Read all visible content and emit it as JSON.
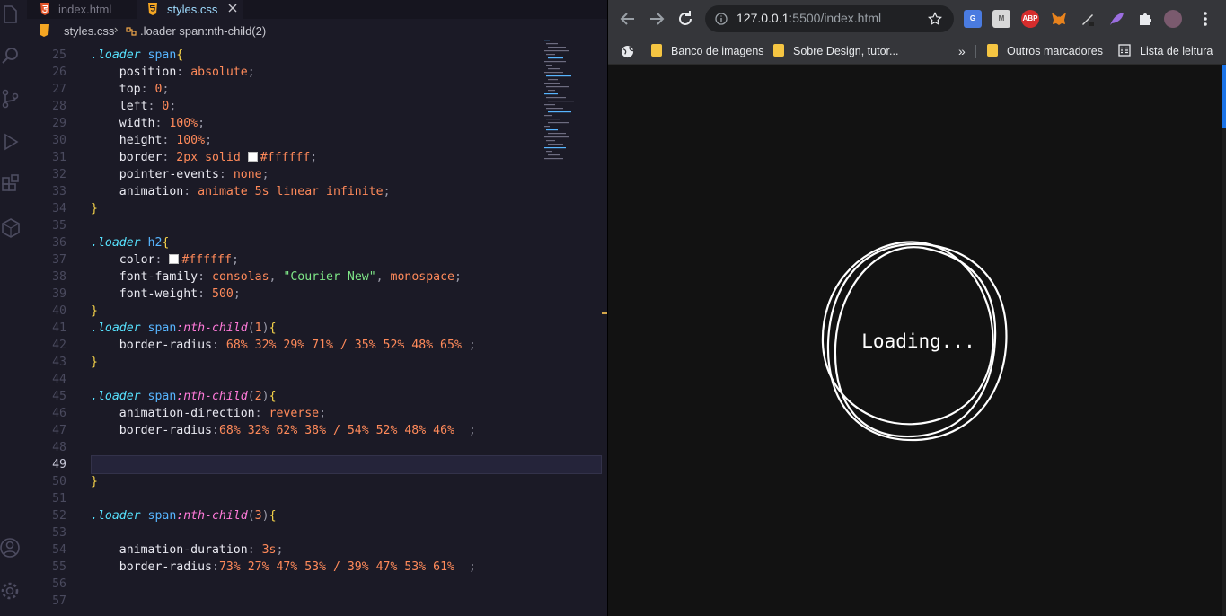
{
  "editor": {
    "tabs": [
      {
        "label": "index.html",
        "type": "html"
      },
      {
        "label": "styles.css",
        "type": "css",
        "active": true
      }
    ],
    "breadcrumb": {
      "file": "styles.css",
      "selector": ".loader span:nth-child(2)"
    },
    "active_line": "49"
  },
  "browser": {
    "url_host": "127.0.0.1",
    "url_rest": ":5500/index.html",
    "bookmarks": [
      "Banco de imagens",
      "Sobre Design, tutor...",
      "Outros marcadores",
      "Lista de leitura"
    ],
    "overflow": "»",
    "extensions": [
      "G",
      "M",
      "ABP",
      "fox",
      "pen",
      "feather",
      "puzzle",
      "avatar"
    ],
    "page_text": "Loading..."
  },
  "code": [
    {
      "n": "25",
      "t": [
        [
          "sel",
          ".loader"
        ],
        [
          "txt",
          " "
        ],
        [
          "tag",
          "span"
        ],
        [
          "br",
          "{"
        ]
      ]
    },
    {
      "n": "26",
      "t": [
        [
          "txt",
          "    "
        ],
        [
          "prop",
          "position"
        ],
        [
          "p",
          ": "
        ],
        [
          "val",
          "absolute"
        ],
        [
          "p",
          ";"
        ]
      ]
    },
    {
      "n": "27",
      "t": [
        [
          "txt",
          "    "
        ],
        [
          "prop",
          "top"
        ],
        [
          "p",
          ": "
        ],
        [
          "num",
          "0"
        ],
        [
          "p",
          ";"
        ]
      ]
    },
    {
      "n": "28",
      "t": [
        [
          "txt",
          "    "
        ],
        [
          "prop",
          "left"
        ],
        [
          "p",
          ": "
        ],
        [
          "num",
          "0"
        ],
        [
          "p",
          ";"
        ]
      ]
    },
    {
      "n": "29",
      "t": [
        [
          "txt",
          "    "
        ],
        [
          "prop",
          "width"
        ],
        [
          "p",
          ": "
        ],
        [
          "num",
          "100%"
        ],
        [
          "p",
          ";"
        ]
      ]
    },
    {
      "n": "30",
      "t": [
        [
          "txt",
          "    "
        ],
        [
          "prop",
          "height"
        ],
        [
          "p",
          ": "
        ],
        [
          "num",
          "100%"
        ],
        [
          "p",
          ";"
        ]
      ]
    },
    {
      "n": "31",
      "t": [
        [
          "txt",
          "    "
        ],
        [
          "prop",
          "border"
        ],
        [
          "p",
          ": "
        ],
        [
          "num",
          "2px"
        ],
        [
          "val",
          " solid "
        ],
        [
          "sw",
          ""
        ],
        [
          "val",
          "#ffffff"
        ],
        [
          "p",
          ";"
        ]
      ]
    },
    {
      "n": "32",
      "t": [
        [
          "txt",
          "    "
        ],
        [
          "prop",
          "pointer-events"
        ],
        [
          "p",
          ": "
        ],
        [
          "val",
          "none"
        ],
        [
          "p",
          ";"
        ]
      ]
    },
    {
      "n": "33",
      "t": [
        [
          "txt",
          "    "
        ],
        [
          "prop",
          "animation"
        ],
        [
          "p",
          ": "
        ],
        [
          "val",
          "animate 5s linear infinite"
        ],
        [
          "p",
          ";"
        ]
      ]
    },
    {
      "n": "34",
      "t": [
        [
          "br",
          "}"
        ]
      ]
    },
    {
      "n": "35",
      "t": []
    },
    {
      "n": "36",
      "t": [
        [
          "sel",
          ".loader"
        ],
        [
          "txt",
          " "
        ],
        [
          "tag",
          "h2"
        ],
        [
          "br",
          "{"
        ]
      ]
    },
    {
      "n": "37",
      "t": [
        [
          "txt",
          "    "
        ],
        [
          "prop",
          "color"
        ],
        [
          "p",
          ": "
        ],
        [
          "sw",
          ""
        ],
        [
          "val",
          "#ffffff"
        ],
        [
          "p",
          ";"
        ]
      ]
    },
    {
      "n": "38",
      "t": [
        [
          "txt",
          "    "
        ],
        [
          "prop",
          "font-family"
        ],
        [
          "p",
          ": "
        ],
        [
          "val",
          "consolas"
        ],
        [
          "p",
          ", "
        ],
        [
          "str",
          "\"Courier New\""
        ],
        [
          "p",
          ", "
        ],
        [
          "val",
          "monospace"
        ],
        [
          "p",
          ";"
        ]
      ]
    },
    {
      "n": "39",
      "t": [
        [
          "txt",
          "    "
        ],
        [
          "prop",
          "font-weight"
        ],
        [
          "p",
          ": "
        ],
        [
          "num",
          "500"
        ],
        [
          "p",
          ";"
        ]
      ]
    },
    {
      "n": "40",
      "t": [
        [
          "br",
          "}"
        ]
      ]
    },
    {
      "n": "41",
      "t": [
        [
          "sel",
          ".loader"
        ],
        [
          "txt",
          " "
        ],
        [
          "tag",
          "span"
        ],
        [
          "pp",
          ":nth-child"
        ],
        [
          "p",
          "("
        ],
        [
          "num",
          "1"
        ],
        [
          "p",
          ")"
        ],
        [
          "br",
          "{"
        ]
      ]
    },
    {
      "n": "42",
      "t": [
        [
          "txt",
          "    "
        ],
        [
          "prop",
          "border-radius"
        ],
        [
          "p",
          ": "
        ],
        [
          "num",
          "68% 32% 29% 71% / 35% 52% 48% 65%"
        ],
        [
          "p",
          " ;"
        ]
      ]
    },
    {
      "n": "43",
      "t": [
        [
          "br",
          "}"
        ]
      ]
    },
    {
      "n": "44",
      "t": []
    },
    {
      "n": "45",
      "t": [
        [
          "sel",
          ".loader"
        ],
        [
          "txt",
          " "
        ],
        [
          "tag",
          "span"
        ],
        [
          "pp",
          ":nth-child"
        ],
        [
          "p",
          "("
        ],
        [
          "num",
          "2"
        ],
        [
          "p",
          ")"
        ],
        [
          "br",
          "{"
        ]
      ]
    },
    {
      "n": "46",
      "t": [
        [
          "txt",
          "    "
        ],
        [
          "prop",
          "animation-direction"
        ],
        [
          "p",
          ": "
        ],
        [
          "val",
          "reverse"
        ],
        [
          "p",
          ";"
        ]
      ]
    },
    {
      "n": "47",
      "t": [
        [
          "txt",
          "    "
        ],
        [
          "prop",
          "border-radius"
        ],
        [
          "p",
          ":"
        ],
        [
          "num",
          "68% 32% 62% 38% / 54% 52% 48% 46%"
        ],
        [
          "p",
          "  ;"
        ]
      ]
    },
    {
      "n": "48",
      "t": []
    },
    {
      "n": "49",
      "t": []
    },
    {
      "n": "50",
      "t": [
        [
          "br",
          "}"
        ]
      ]
    },
    {
      "n": "51",
      "t": []
    },
    {
      "n": "52",
      "t": [
        [
          "sel",
          ".loader"
        ],
        [
          "txt",
          " "
        ],
        [
          "tag",
          "span"
        ],
        [
          "pp",
          ":nth-child"
        ],
        [
          "p",
          "("
        ],
        [
          "num",
          "3"
        ],
        [
          "p",
          ")"
        ],
        [
          "br",
          "{"
        ]
      ]
    },
    {
      "n": "53",
      "t": []
    },
    {
      "n": "54",
      "t": [
        [
          "txt",
          "    "
        ],
        [
          "prop",
          "animation-duration"
        ],
        [
          "p",
          ": "
        ],
        [
          "num",
          "3s"
        ],
        [
          "p",
          ";"
        ]
      ]
    },
    {
      "n": "55",
      "t": [
        [
          "txt",
          "    "
        ],
        [
          "prop",
          "border-radius"
        ],
        [
          "p",
          ":"
        ],
        [
          "num",
          "73% 27% 47% 53% / 39% 47% 53% 61%"
        ],
        [
          "p",
          "  ;"
        ]
      ]
    },
    {
      "n": "56",
      "t": []
    },
    {
      "n": "57",
      "t": []
    }
  ]
}
